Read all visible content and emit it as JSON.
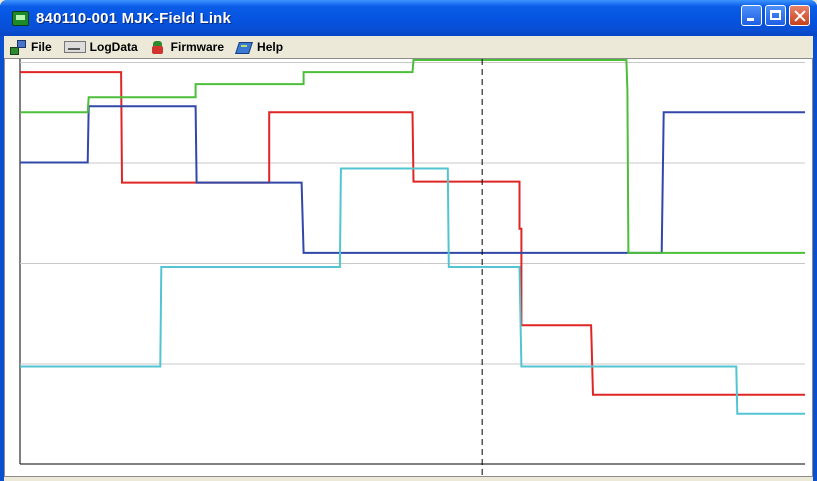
{
  "window": {
    "title": "840110-001 MJK-Field Link",
    "controls": {
      "minimize": "minimize",
      "maximize": "maximize",
      "close": "close"
    }
  },
  "menu": {
    "items": [
      {
        "label": "File",
        "icon": "file-network-icon"
      },
      {
        "label": "LogData",
        "icon": "logdata-icon"
      },
      {
        "label": "Firmware",
        "icon": "firmware-icon"
      },
      {
        "label": "Help",
        "icon": "help-book-icon"
      }
    ]
  },
  "colors": {
    "titlebar": "#0a5de8",
    "chart_background": "#ffffff",
    "gridline": "#c8c8c8",
    "cursor_line": "#000000",
    "series": [
      "#e02525",
      "#3148a8",
      "#4cbe3a",
      "#52c4d2"
    ]
  },
  "chart_data": {
    "type": "line",
    "step": true,
    "grid": true,
    "legend": "none",
    "xlim": [
      0,
      800
    ],
    "ylim": [
      0,
      400
    ],
    "cursor_x": 471,
    "series": [
      {
        "color": "#e02525",
        "points": [
          [
            0,
            390
          ],
          [
            101,
            390
          ],
          [
            103,
            390
          ],
          [
            104,
            280
          ],
          [
            254,
            280
          ],
          [
            254,
            350
          ],
          [
            400,
            350
          ],
          [
            401,
            281
          ],
          [
            509,
            281
          ],
          [
            509,
            234
          ],
          [
            511,
            234
          ],
          [
            511,
            138
          ],
          [
            582,
            138
          ],
          [
            584,
            69
          ],
          [
            800,
            69
          ]
        ]
      },
      {
        "color": "#3148a8",
        "points": [
          [
            0,
            300
          ],
          [
            69,
            300
          ],
          [
            70,
            356
          ],
          [
            179,
            356
          ],
          [
            180,
            280
          ],
          [
            287,
            280
          ],
          [
            289,
            210
          ],
          [
            654,
            210
          ],
          [
            656,
            350
          ],
          [
            800,
            350
          ]
        ]
      },
      {
        "color": "#4cbe3a",
        "points": [
          [
            0,
            350
          ],
          [
            69,
            350
          ],
          [
            70,
            365
          ],
          [
            179,
            365
          ],
          [
            179,
            378
          ],
          [
            289,
            378
          ],
          [
            289,
            390
          ],
          [
            400,
            390
          ],
          [
            401,
            402
          ],
          [
            618,
            402
          ],
          [
            619,
            372
          ],
          [
            620,
            210
          ],
          [
            800,
            210
          ]
        ]
      },
      {
        "color": "#52c4d2",
        "points": [
          [
            0,
            97
          ],
          [
            143,
            97
          ],
          [
            144,
            196
          ],
          [
            326,
            196
          ],
          [
            327,
            294
          ],
          [
            436,
            294
          ],
          [
            437,
            196
          ],
          [
            509,
            196
          ],
          [
            511,
            97
          ],
          [
            730,
            97
          ],
          [
            731,
            50
          ],
          [
            800,
            50
          ]
        ]
      }
    ]
  }
}
